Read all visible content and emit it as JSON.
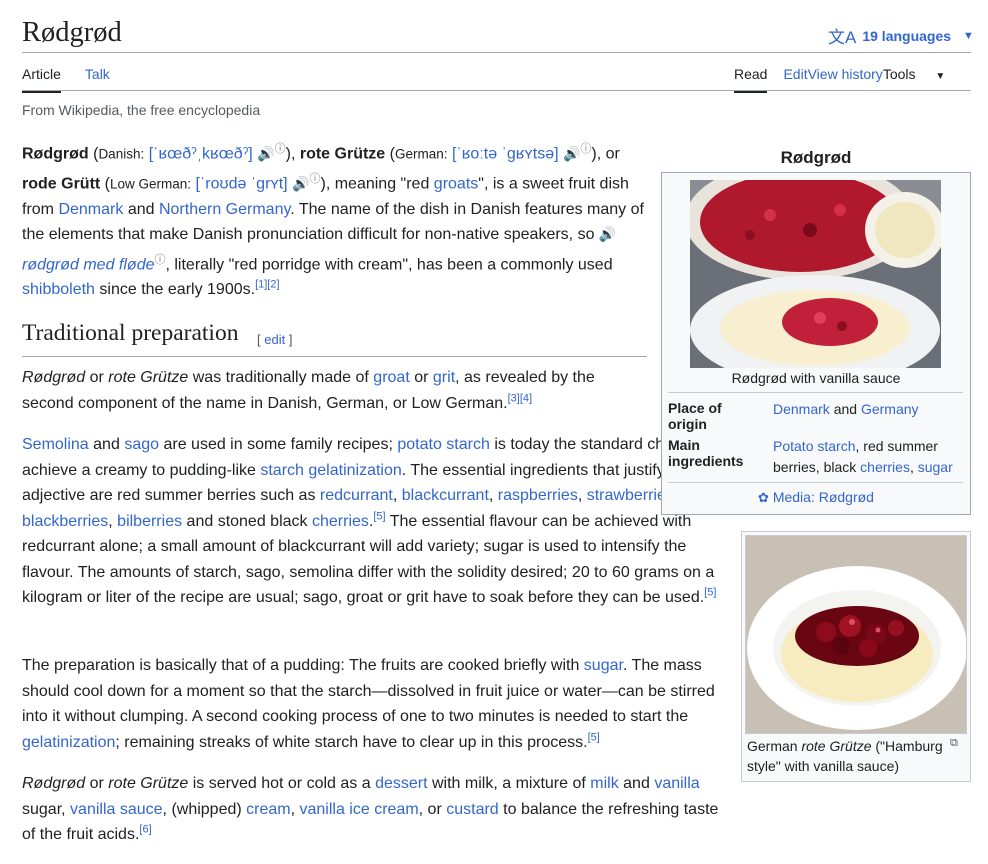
{
  "header": {
    "title": "Rødgrød",
    "lang_count": "19 languages",
    "tabs_left": [
      "Article",
      "Talk"
    ],
    "tabs_right": [
      "Read",
      "Edit",
      "View history"
    ],
    "tools": "Tools",
    "tagline": "From Wikipedia, the free encyclopedia"
  },
  "intro": {
    "bold1": "Rødgrød",
    "paren_open": "(",
    "lang1": "Danish",
    "colon": ":",
    "ipa1": "[ˈʁœðˀˌkʁœðˀ]",
    "mid1": "),",
    "bold2": "rote Grütze",
    "lang2": "German",
    "ipa2": "[ˈʁoːtə ˈɡʁʏtsə]",
    "mid2": "), or",
    "bold3": "rode Grütt",
    "lang3": "Low German",
    "ipa3": "[ˈroʊdə ˈɡrʏt]",
    "meaning": "), meaning \"red",
    "groats": "groats",
    "rest1": "\", is a sweet fruit dish",
    "from": "from",
    "denmark": "Denmark",
    "and": "and",
    "northern_germany": "Northern Germany",
    "rest2": ". The name of the dish in Danish features many of the elements that make Danish pronunciation difficult for non-native speakers, so",
    "phrase": "rødgrød med fløde",
    "rest3": ", literally \"red porridge with cream\", has been a commonly used",
    "shibboleth": "shibboleth",
    "rest4": "since the early 1900s.",
    "refs": "[1][2]"
  },
  "section": {
    "heading": "Traditional preparation",
    "edit_open": "[",
    "edit": "edit",
    "edit_close": "]"
  },
  "p1": {
    "i1": "Rødgrød",
    "t1": "or",
    "i2": "rote Grütze",
    "t2": "was traditionally made of",
    "groat": "groat",
    "t3": "or",
    "grit": "grit",
    "t4": ", as revealed by the second component of the name in Danish, German, or Low German.",
    "refs": "[3][4]"
  },
  "p2": {
    "semolina": "Semolina",
    "t1": "and",
    "sago": "sago",
    "t2": "are used in some family recipes;",
    "potato_starch": "potato starch",
    "t3": "is today the standard choice to achieve a creamy to pudding-like",
    "starch_gel": "starch gelatinization",
    "t4": ". The essential ingredients that justify the adjective are red summer berries such as",
    "redcurrant": "redcurrant",
    "comma": ",",
    "blackcurrant": "blackcurrant",
    "raspberries": "raspberries",
    "strawberries": "strawberries",
    "blackberries": "blackberries",
    "bilberries": "bilberries",
    "t5": "and stoned black",
    "cherries": "cherries",
    "ref5": "[5]",
    "t6": "The essential flavour can be achieved with redcurrant alone; a small amount of blackcurrant will add variety; sugar is used to intensify the flavour. The amounts of starch, sago, semolina differ with the solidity desired; 20 to 60 grams on a kilogram or liter of the recipe are usual; sago, groat or grit have to soak before they can be used.",
    "ref5b": "[5]"
  },
  "p3": {
    "t1": "The preparation is basically that of a pudding: The fruits are cooked briefly with",
    "sugar": "sugar",
    "t2": ". The mass should cool down for a moment so that the starch—dissolved in fruit juice or water—can be stirred into it without clumping. A second cooking process of one to two minutes is needed to start the",
    "gelatinization": "gelatinization",
    "t3": "; remaining streaks of white starch have to clear up in this process.",
    "ref5": "[5]"
  },
  "p4": {
    "i1": "Rødgrød",
    "t1": "or",
    "i2": "rote Grütze",
    "t2": "is served hot or cold as a",
    "dessert": "dessert",
    "t3": "with milk, a mixture of",
    "milk": "milk",
    "t4": "and",
    "vanilla": "vanilla",
    "t5": "sugar,",
    "vanilla_sauce": "vanilla sauce",
    "t6": ", (whipped)",
    "cream": "cream",
    "vanilla_ice_cream": "vanilla ice cream",
    "t7": ", or",
    "custard": "custard",
    "t8": "to balance the refreshing taste of the fruit acids.",
    "ref6": "[6]"
  },
  "infobox": {
    "title": "Rødgrød",
    "caption": "Rødgrød with vanilla sauce",
    "place_label": "Place of origin",
    "place_denmark": "Denmark",
    "place_and": "and",
    "place_germany": "Germany",
    "ingredients_label": "Main ingredients",
    "ing_potato": "Potato starch",
    "ing_mid": ", red summer berries, black",
    "ing_cherries": "cherries",
    "ing_sep": ",",
    "ing_sugar": "sugar",
    "media": "Media: Rødgrød"
  },
  "thumb2": {
    "cap1": "German",
    "cap_italic": "rote Grütze",
    "cap2": "(\"Hamburg style\" with vanilla sauce)"
  },
  "colors": {
    "link": "#3366cc",
    "text": "#202122",
    "border": "#a2a9b1"
  }
}
